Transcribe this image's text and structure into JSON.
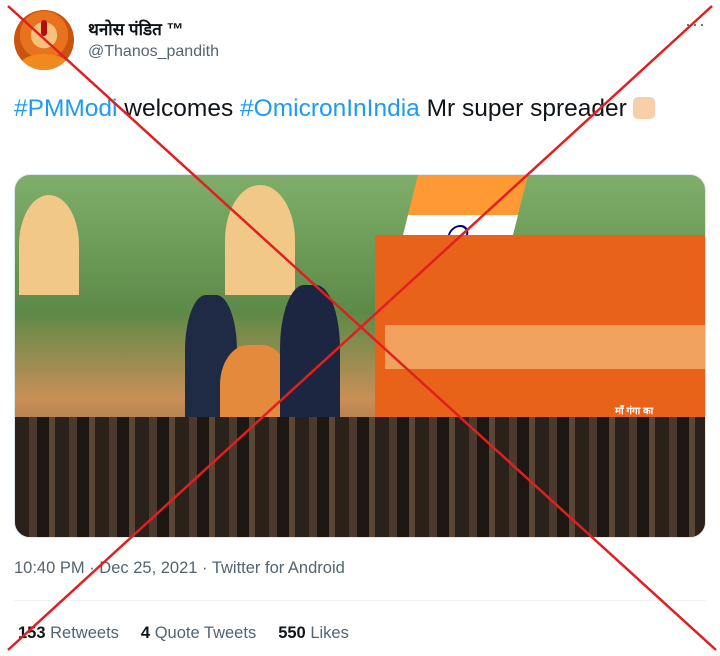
{
  "header": {
    "display_name": "थनोस पंडित ™",
    "handle": "@Thanos_pandith",
    "more_label": "···"
  },
  "tweet": {
    "hashtag1": "#PMModi",
    "text1": " welcomes  ",
    "hashtag2": "#OmicronInIndia",
    "text2": " Mr super spreader"
  },
  "photo": {
    "sign_text": "माँ गंगा का"
  },
  "meta": {
    "time": "10:40 PM",
    "separator": " · ",
    "date": "Dec 25, 2021",
    "source": "Twitter for Android"
  },
  "stats": {
    "retweets_count": "153",
    "retweets_label": "Retweets",
    "quotes_count": "4",
    "quotes_label": "Quote Tweets",
    "likes_count": "550",
    "likes_label": "Likes"
  },
  "colors": {
    "hashtag": "#1d9bf0",
    "cross": "#e02020",
    "secondary_text": "#536471"
  },
  "icons": [
    "more-options-icon",
    "thumbs-up-emoji-icon"
  ]
}
